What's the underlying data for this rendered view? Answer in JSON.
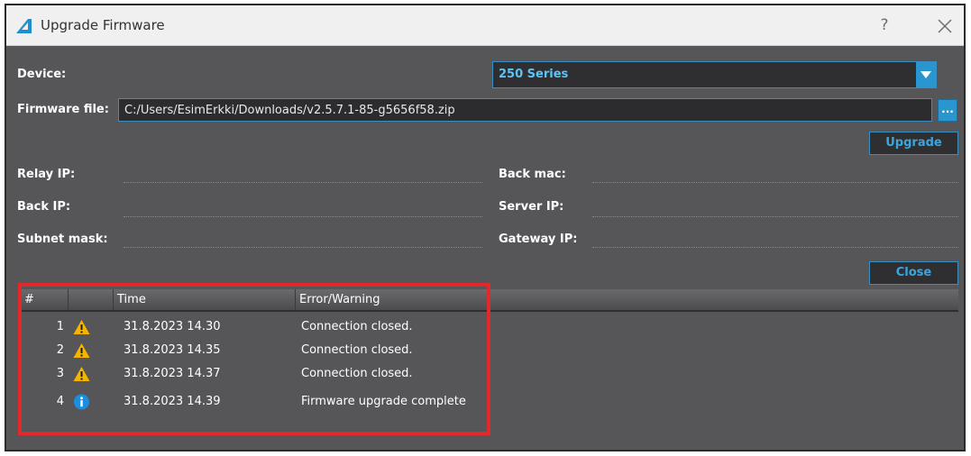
{
  "window": {
    "title": "Upgrade Firmware",
    "help_glyph": "?"
  },
  "device": {
    "label": "Device:",
    "selected": "250 Series"
  },
  "firmware": {
    "label": "Firmware file:",
    "path": "C:/Users/EsimErkki/Downloads/v2.5.7.1-85-g5656f58.zip",
    "browse_label": "..."
  },
  "buttons": {
    "upgrade": "Upgrade",
    "close": "Close"
  },
  "fields": {
    "relay_ip": "Relay IP:",
    "back_mac": "Back mac:",
    "back_ip": "Back IP:",
    "server_ip": "Server IP:",
    "subnet_mask": "Subnet mask:",
    "gateway_ip": "Gateway IP:"
  },
  "log": {
    "columns": [
      "#",
      "",
      "Time",
      "Error/Warning"
    ],
    "rows": [
      {
        "num": "1",
        "icon": "warning-icon",
        "time": "31.8.2023 14.30",
        "message": "Connection closed."
      },
      {
        "num": "2",
        "icon": "warning-icon",
        "time": "31.8.2023 14.35",
        "message": "Connection closed."
      },
      {
        "num": "3",
        "icon": "warning-icon",
        "time": "31.8.2023 14.37",
        "message": "Connection closed."
      },
      {
        "num": "4",
        "icon": "info-icon",
        "time": "31.8.2023 14.39",
        "message": "Firmware upgrade complete"
      }
    ]
  },
  "colors": {
    "background": "#565659",
    "accent": "#2a96cf",
    "highlight": "#e4282a",
    "warning": "#f5b400"
  }
}
